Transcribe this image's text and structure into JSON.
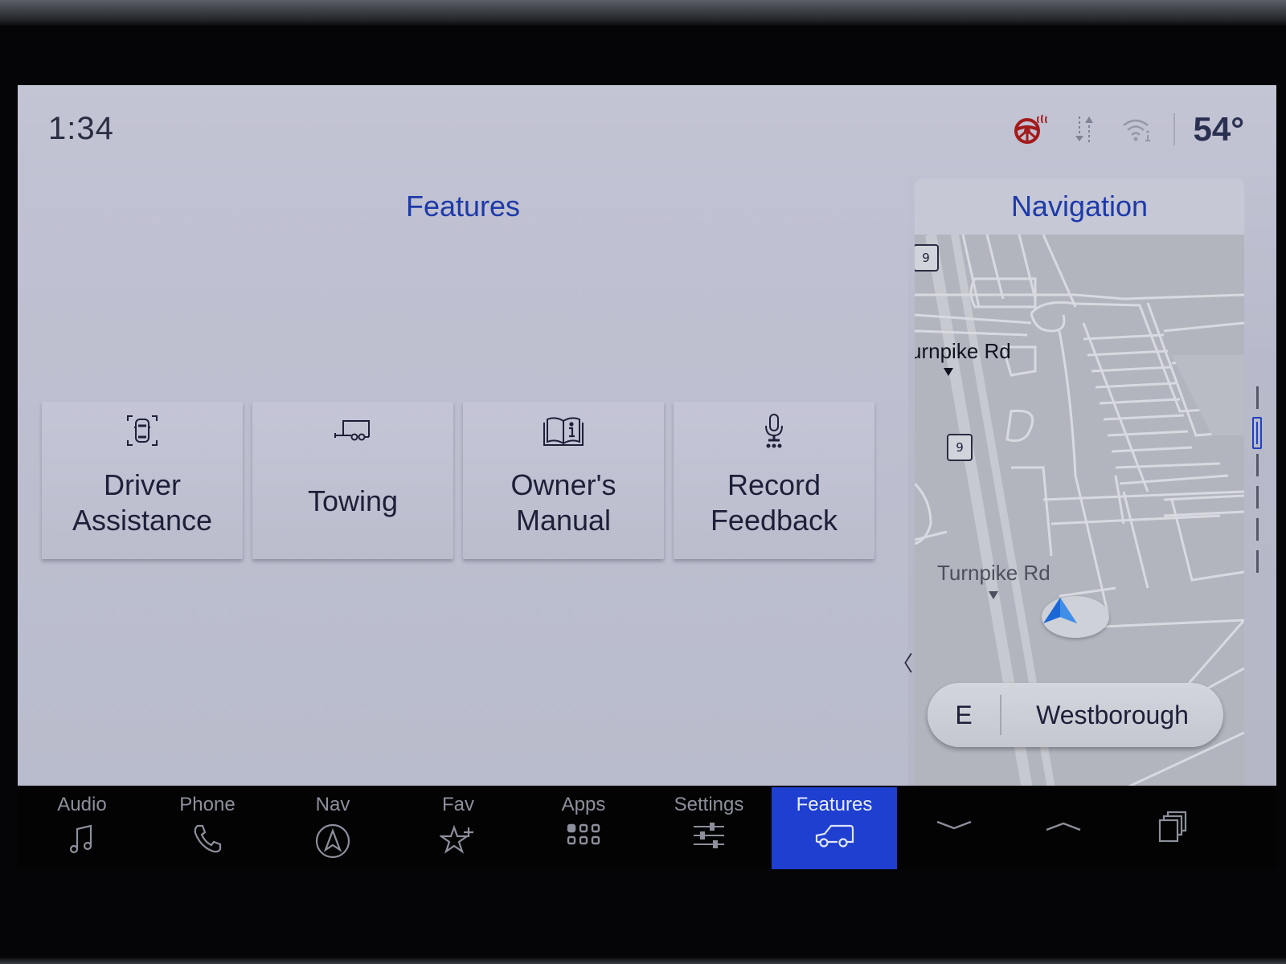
{
  "status_bar": {
    "time": "1:34",
    "temperature": "54°",
    "icons": [
      "heated-steering-wheel-icon",
      "data-transfer-icon",
      "wifi-info-icon"
    ],
    "heated_wheel_color": "#a31b1b"
  },
  "features": {
    "title": "Features",
    "tiles": [
      {
        "icon": "driver-assistance-icon",
        "label_line1": "Driver",
        "label_line2": "Assistance"
      },
      {
        "icon": "trailer-icon",
        "label_line1": "Towing",
        "label_line2": ""
      },
      {
        "icon": "owners-manual-icon",
        "label_line1": "Owner's",
        "label_line2": "Manual"
      },
      {
        "icon": "microphone-icon",
        "label_line1": "Record",
        "label_line2": "Feedback"
      }
    ],
    "collapse_handle": "〈"
  },
  "navigation": {
    "title": "Navigation",
    "road_label_top": "urnpike Rd",
    "road_label_bottom": "Turnpike Rd",
    "route_shields": [
      "9",
      "9"
    ],
    "heading_direction": "E",
    "heading_city": "Westborough"
  },
  "page_indicator": {
    "pages": 6,
    "active_index": 1
  },
  "dock": {
    "items": [
      {
        "label": "Audio",
        "icon": "music-note-icon",
        "active": false
      },
      {
        "label": "Phone",
        "icon": "phone-icon",
        "active": false
      },
      {
        "label": "Nav",
        "icon": "navigation-compass-icon",
        "active": false
      },
      {
        "label": "Fav",
        "icon": "favorite-add-icon",
        "active": false
      },
      {
        "label": "Apps",
        "icon": "apps-grid-icon",
        "active": false
      },
      {
        "label": "Settings",
        "icon": "settings-sliders-icon",
        "active": false
      },
      {
        "label": "Features",
        "icon": "vehicle-icon",
        "active": true
      }
    ],
    "controls": [
      "chevron-down-icon",
      "chevron-up-icon",
      "app-switcher-icon"
    ],
    "active_color": "#1f3fd0"
  }
}
